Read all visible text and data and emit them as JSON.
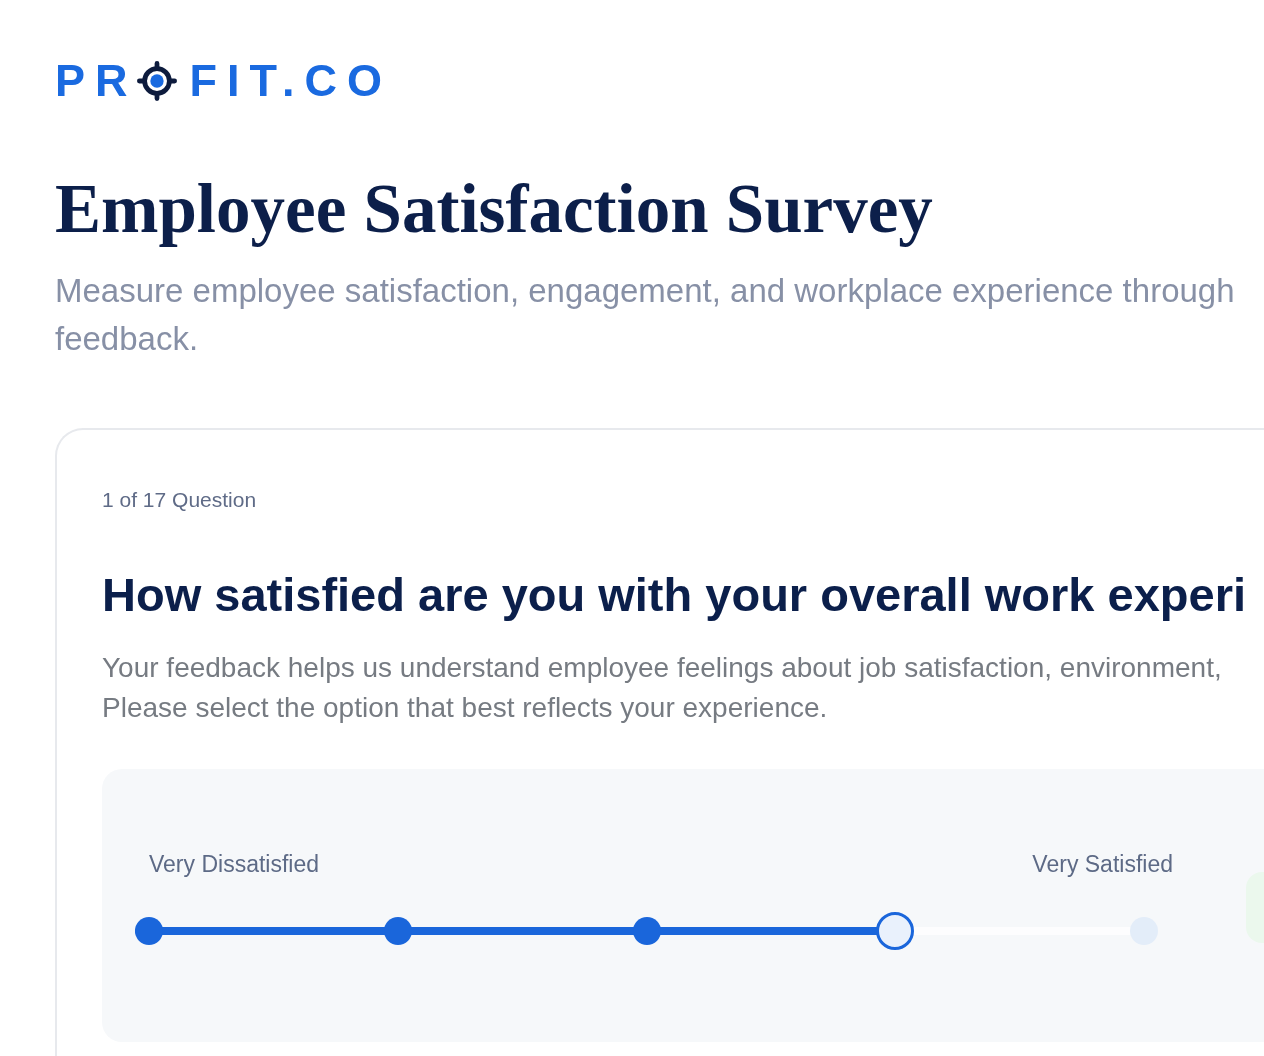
{
  "logo": {
    "lead": "PR",
    "trail": "FIT.CO"
  },
  "title": "Employee Satisfaction Survey",
  "subtitle": "Measure employee satisfaction, engagement, and workplace experience through\nfeedback.",
  "question": {
    "counter": "1 of 17 Question",
    "title": "How satisfied are you with your overall work experi",
    "description": "Your feedback helps us understand employee feelings about job satisfaction, environment,\nPlease select the option that best reflects your experience.",
    "scale": {
      "min_label": "Very Dissatisfied",
      "max_label": "Very Satisfied",
      "level": 0.75,
      "points": [
        {
          "selected": false
        },
        {
          "selected": false
        },
        {
          "selected": false
        },
        {
          "selected": true
        },
        {
          "selected": false
        }
      ]
    }
  }
}
